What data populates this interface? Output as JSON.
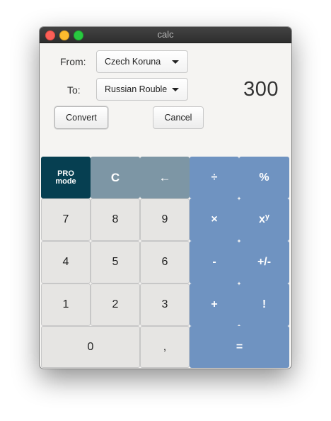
{
  "window": {
    "title": "calc"
  },
  "converter": {
    "from_label": "From:",
    "to_label": "To:",
    "from_value": "Czech Koruna",
    "to_value": "Russian Rouble",
    "convert_label": "Convert",
    "cancel_label": "Cancel"
  },
  "display": {
    "value": "300"
  },
  "keypad": {
    "pro_line1": "PRO",
    "pro_line2": "mode",
    "clear": "C",
    "backspace": "←",
    "divide": "÷",
    "percent": "%",
    "seven": "7",
    "eight": "8",
    "nine": "9",
    "multiply": "×",
    "power_base": "x",
    "power_exp": "y",
    "four": "4",
    "five": "5",
    "six": "6",
    "subtract": "-",
    "sign": "+/-",
    "one": "1",
    "two": "2",
    "three": "3",
    "add": "+",
    "factorial": "!",
    "zero": "0",
    "decimal": ",",
    "equals": "="
  },
  "colors": {
    "pro_key": "#063f51",
    "control_keys": "#7d96a5",
    "operator_keys": "#6f93c1",
    "number_keys": "#e6e5e3"
  },
  "icons": {
    "window_close": "close-traffic-light",
    "window_minimize": "minimize-traffic-light",
    "window_maximize": "maximize-traffic-light",
    "dropdown": "chevron-down-icon"
  }
}
